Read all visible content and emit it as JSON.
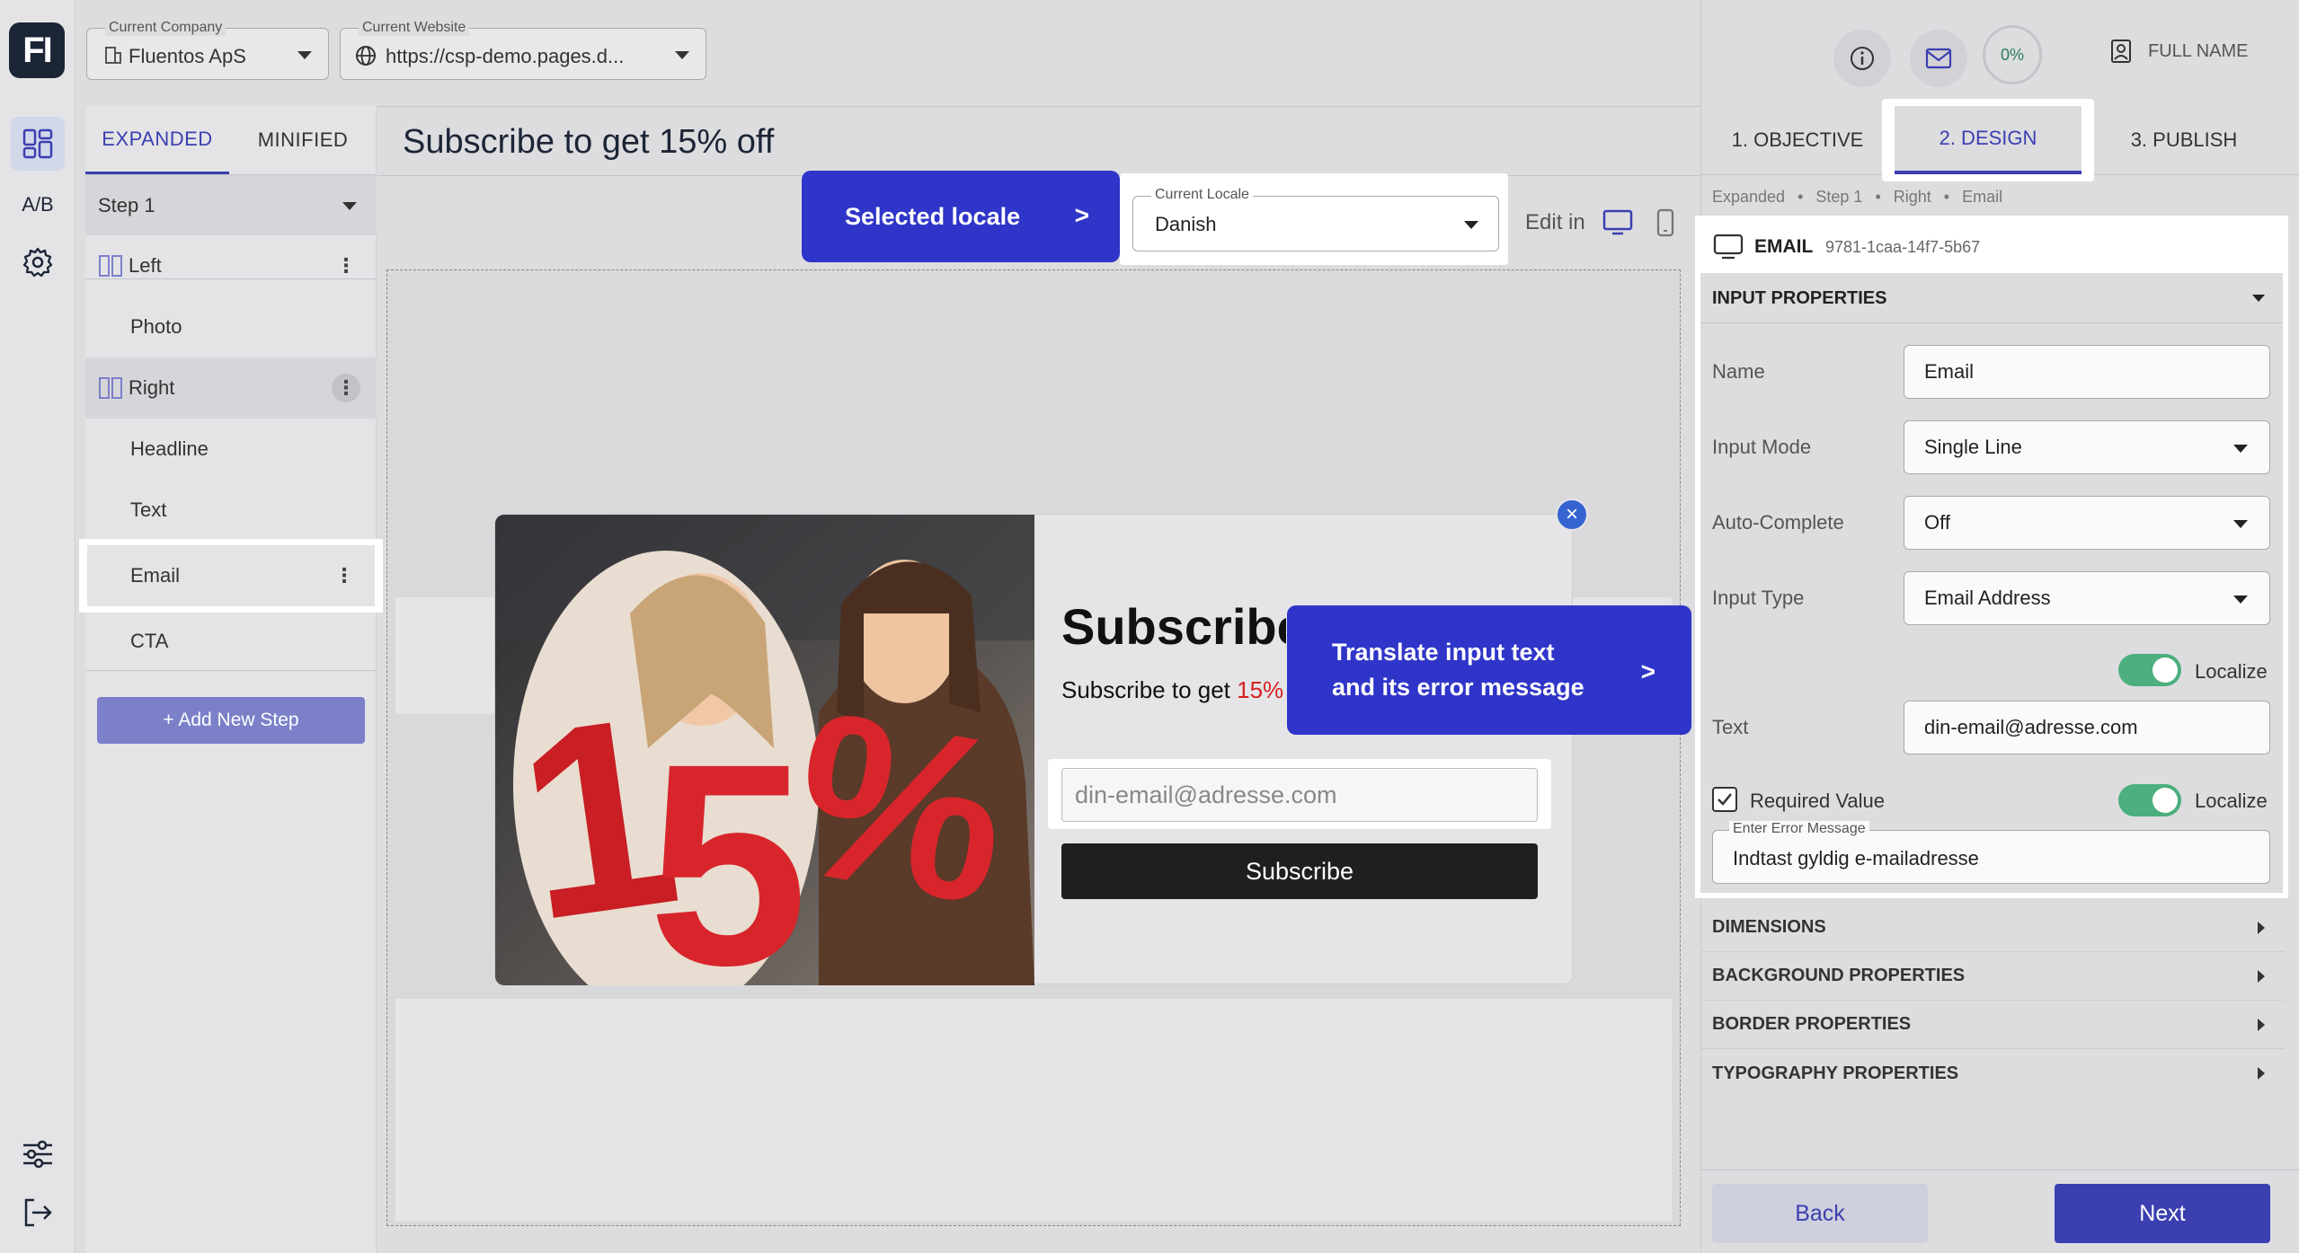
{
  "rail": {
    "logo": "FI",
    "ab_label": "A/B"
  },
  "topbar": {
    "company_label": "Current Company",
    "company_value": "Fluentos ApS",
    "website_label": "Current Website",
    "website_value": "https://csp-demo.pages.d...",
    "progress": "0%",
    "user_name": "FULL NAME"
  },
  "left_panel": {
    "tabs": [
      "EXPANDED",
      "MINIFIED"
    ],
    "step_select": "Step 1",
    "tree": [
      {
        "label": "Left",
        "kind": "column"
      },
      {
        "label": "Photo",
        "kind": "child"
      },
      {
        "label": "Right",
        "kind": "column"
      },
      {
        "label": "Headline",
        "kind": "child"
      },
      {
        "label": "Text",
        "kind": "child"
      },
      {
        "label": "Email",
        "kind": "child"
      },
      {
        "label": "CTA",
        "kind": "child"
      }
    ],
    "add_step": "+ Add New Step"
  },
  "main": {
    "page_title": "Subscribe to get 15% off",
    "callout_locale": "Selected locale",
    "callout_arrow": ">",
    "locale_label": "Current Locale",
    "locale_value": "Danish",
    "edit_in": "Edit in",
    "popup": {
      "headline": "Subscribe",
      "subtext": "Subscribe to get ",
      "subtext_highlight": "15%",
      "email_placeholder": "din-email@adresse.com",
      "cta": "Subscribe",
      "image_text": "15%"
    },
    "callout_translate": "Translate input text and its error message",
    "callout_translate_arrow": ">"
  },
  "right_panel": {
    "tabs": [
      "1. OBJECTIVE",
      "2. DESIGN",
      "3. PUBLISH"
    ],
    "breadcrumb": [
      "Expanded",
      "Step 1",
      "Right",
      "Email"
    ],
    "element_type": "EMAIL",
    "element_id": "9781-1caa-14f7-5b67",
    "input_properties": "INPUT PROPERTIES",
    "props": {
      "name_label": "Name",
      "name_value": "Email",
      "mode_label": "Input Mode",
      "mode_value": "Single Line",
      "autocomplete_label": "Auto-Complete",
      "autocomplete_value": "Off",
      "type_label": "Input Type",
      "type_value": "Email Address",
      "localize": "Localize",
      "text_label": "Text",
      "text_value": "din-email@adresse.com",
      "required_label": "Required Value",
      "error_label": "Enter Error Message",
      "error_value": "Indtast gyldig e-mailadresse"
    },
    "sections": [
      "DIMENSIONS",
      "BACKGROUND PROPERTIES",
      "BORDER PROPERTIES",
      "TYPOGRAPHY PROPERTIES"
    ],
    "back": "Back",
    "next": "Next"
  },
  "colors": {
    "accent": "#3b3fb0",
    "callout": "#2f35c8",
    "toggle_on": "#4caf7d",
    "highlight_red": "#d62020"
  }
}
